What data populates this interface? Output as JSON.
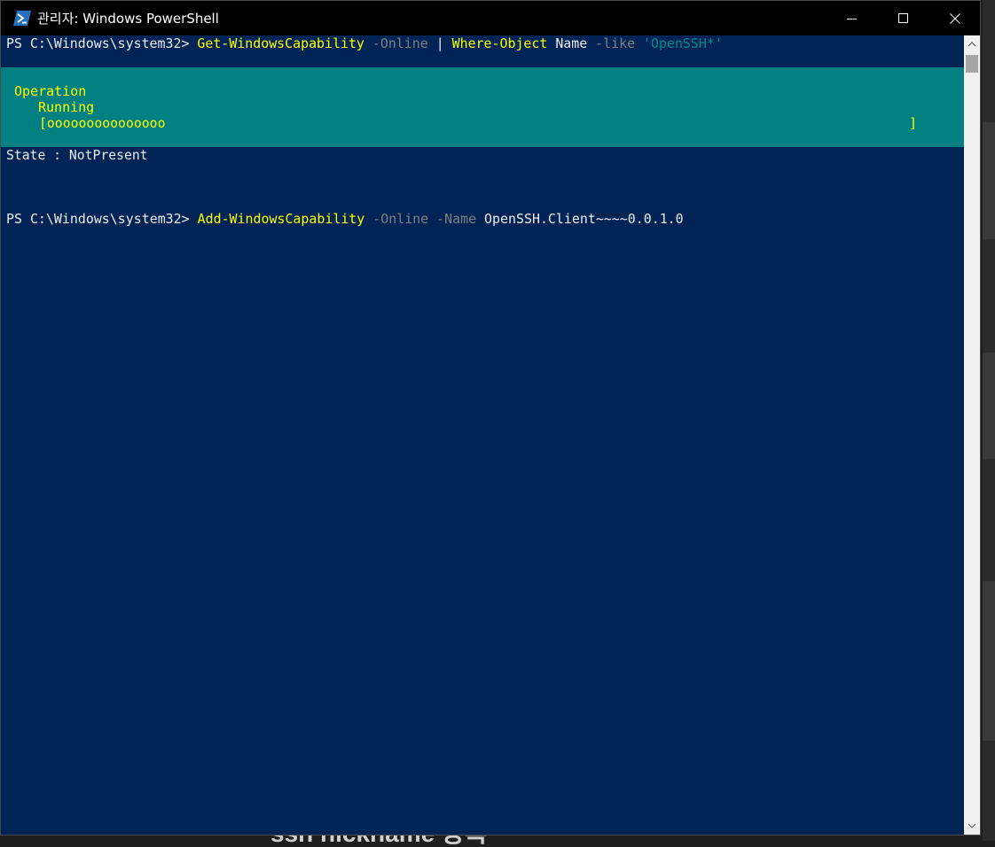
{
  "window": {
    "title": "관리자: Windows PowerShell",
    "icon": "powershell-icon",
    "controls": [
      "minimize-icon",
      "maximize-icon",
      "close-icon"
    ]
  },
  "background": {
    "partial_text": "ssh nickname 등록"
  },
  "console": {
    "line1": {
      "prompt": "PS C:\\Windows\\system32> ",
      "cmd1": "Get-WindowsCapability",
      "param1": " -Online ",
      "pipe": "|",
      "sp": " ",
      "cmd2": "Where-Object",
      "arg": " Name ",
      "param2": "-like ",
      "str": "'OpenSSH*'"
    },
    "progress": {
      "operation": "Operation",
      "status": "Running",
      "bar": "[ooooooooooooooo",
      "bar_end": "]"
    },
    "state_line": "State : NotPresent",
    "line2": {
      "prompt": "PS C:\\Windows\\system32> ",
      "cmd": "Add-WindowsCapability",
      "param1": " -Online ",
      "param2": "-Name ",
      "arg": "OpenSSH.Client~~~~0.0.1.0"
    }
  },
  "colors": {
    "console_bg": "#012456",
    "progress_bg": "#008080",
    "command": "#ffff00",
    "parameter": "#808080",
    "string": "#008b8b",
    "default_text": "#eeedf0"
  }
}
